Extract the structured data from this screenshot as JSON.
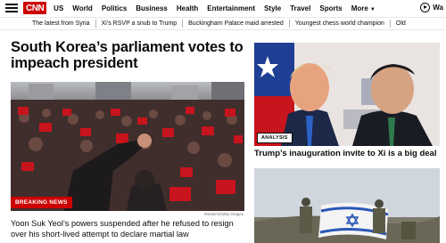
{
  "brand": {
    "logo_text": "CNN",
    "accent": "#cc0000"
  },
  "nav": {
    "items": [
      "US",
      "World",
      "Politics",
      "Business",
      "Health",
      "Entertainment",
      "Style",
      "Travel",
      "Sports"
    ],
    "more_label": "More",
    "watch_label": "Wa"
  },
  "trending": [
    "The latest from Syria",
    "Xi’s RSVP a snub to Trump",
    "Buckingham Palace maid arrested",
    "Youngest chess world champion",
    "Old"
  ],
  "main_story": {
    "headline": "South Korea’s parliament votes to impeach president",
    "badge": "BREAKING NEWS",
    "credit": "Reuters/Getty Images",
    "summary": "Yoon Suk Yeol’s powers suspended after he refused to resign over his short-lived attempt to declare martial law"
  },
  "side_story": {
    "badge": "ANALYSIS",
    "headline": "Trump’s inauguration invite to Xi is a big deal"
  },
  "icons": [
    "menu-icon",
    "play-icon",
    "chevron-down-icon"
  ]
}
